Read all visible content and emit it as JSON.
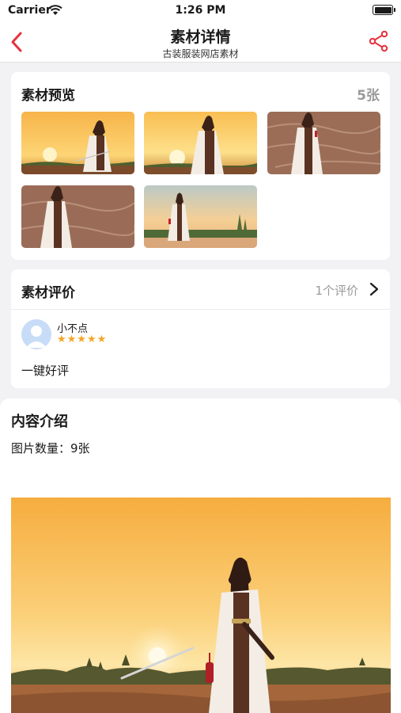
{
  "status_bar": {
    "carrier": "Carrier",
    "time": "1:26 PM"
  },
  "nav": {
    "title": "素材详情",
    "subtitle": "古装服装网店素材",
    "accent_color": "#e5323f"
  },
  "preview": {
    "title": "素材预览",
    "count": "5张",
    "thumbnails": [
      {
        "icon": "sunset-photo",
        "scene": "sunset"
      },
      {
        "icon": "sunset-photo",
        "scene": "sunset"
      },
      {
        "icon": "desert-photo",
        "scene": "desert"
      },
      {
        "icon": "desert-photo",
        "scene": "desert"
      },
      {
        "icon": "lake-photo",
        "scene": "lake"
      }
    ]
  },
  "reviews": {
    "title": "素材评价",
    "count": "1个评价",
    "items": [
      {
        "name": "小不点",
        "stars": "★★★★★",
        "rating": 5,
        "text": "一键好评"
      }
    ]
  },
  "intro": {
    "title": "内容介绍",
    "info": "图片数量：9张"
  }
}
